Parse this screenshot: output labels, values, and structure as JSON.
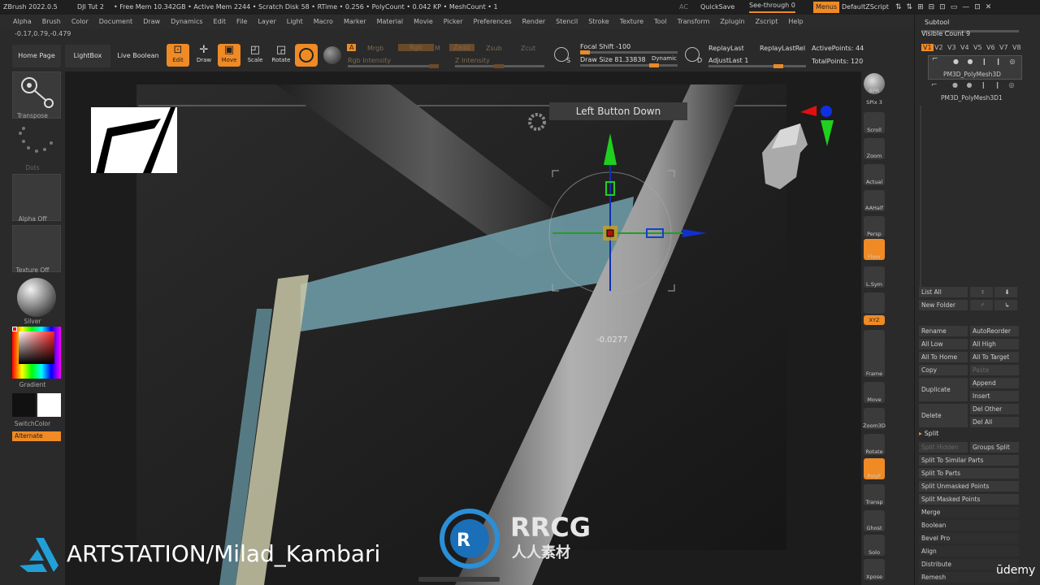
{
  "titlebar": {
    "app": "ZBrush 2022.0.5",
    "doc": "DJI Tut 2",
    "stats": "• Free Mem 10.342GB • Active Mem 2244 • Scratch Disk 58 • RTime • 0.256 • PolyCount • 0.042 KP • MeshCount • 1",
    "ac": "AC",
    "quicksave": "QuickSave",
    "seethrough": "See-through 0",
    "menus": "Menus",
    "script": "DefaultZScript"
  },
  "menu": [
    "Alpha",
    "Brush",
    "Color",
    "Document",
    "Draw",
    "Dynamics",
    "Edit",
    "File",
    "Layer",
    "Light",
    "Macro",
    "Marker",
    "Material",
    "Movie",
    "Picker",
    "Preferences",
    "Render",
    "Stencil",
    "Stroke",
    "Texture",
    "Tool",
    "Transform",
    "Zplugin",
    "Zscript",
    "Help"
  ],
  "coords": "-0.17,0.79,-0.479",
  "shelf": {
    "home": "Home Page",
    "lightbox": "LightBox",
    "liveboolean": "Live Boolean",
    "edit": "Edit",
    "draw": "Draw",
    "move": "Move",
    "scale": "Scale",
    "rotate": "Rotate",
    "a": "A",
    "mrgb": "Mrgb",
    "rgb": "Rgb",
    "m": "M",
    "zadd": "Zadd",
    "zsub": "Zsub",
    "zcut": "Zcut",
    "rgb_intensity": "Rgb Intensity",
    "z_intensity": "Z Intensity",
    "focal_shift": "Focal Shift -100",
    "draw_size": "Draw Size 81.33838",
    "dynamic": "Dynamic",
    "s": "S",
    "d": "D",
    "replay_last": "ReplayLast",
    "replay_last_rel": "ReplayLastRel",
    "adjust_last": "AdjustLast 1",
    "active_points": "ActivePoints: 44",
    "total_points": "TotalPoints: 120"
  },
  "left": {
    "transpose": "Transpose",
    "dots": "Dots",
    "alpha_off": "Alpha Off",
    "texture_off": "Texture Off",
    "silver": "Silver",
    "gradient": "Gradient",
    "switchcolor": "SwitchColor",
    "alternate": "Alternate"
  },
  "viewport": {
    "tooltip": "Left Button Down",
    "value": "-0.0277"
  },
  "right": [
    "BPR",
    "SPix 3",
    "Scroll",
    "Zoom",
    "Actual",
    "AAHalf",
    "Persp",
    "Floor",
    "L.Sym",
    "",
    "XYZ",
    "",
    "",
    "Frame",
    "Move",
    "Zoom3D",
    "Rotate",
    "PolyF",
    "Transp",
    "Ghost",
    "Solo",
    "Xpose"
  ],
  "subtool": {
    "title": "Subtool",
    "visible_count": "Visible Count 9",
    "vtabs": [
      "V1",
      "V2",
      "V3",
      "V4",
      "V5",
      "V6",
      "V7",
      "V8"
    ],
    "items": [
      "PM3D_PolyMesh3D",
      "PM3D_PolyMesh3D1"
    ],
    "list_all": "List All",
    "new_folder": "New Folder",
    "rename": "Rename",
    "autoreorder": "AutoReorder",
    "all_low": "All Low",
    "all_high": "All High",
    "all_to_home": "All To Home",
    "all_to_target": "All To Target",
    "copy": "Copy",
    "paste": "Paste",
    "duplicate": "Duplicate",
    "append": "Append",
    "insert": "Insert",
    "delete": "Delete",
    "del_other": "Del Other",
    "del_all": "Del All",
    "split": "Split",
    "split_hidden": "Split Hidden",
    "groups_split": "Groups Split",
    "split_similar": "Split To Similar Parts",
    "split_parts": "Split To Parts",
    "split_unmasked": "Split Unmasked Points",
    "split_masked": "Split Masked Points",
    "merge": "Merge",
    "boolean": "Boolean",
    "bevel_pro": "Bevel Pro",
    "align": "Align",
    "distribute": "Distribute",
    "remesh": "Remesh"
  },
  "watermark": {
    "artstation": "ARTSTATION/Milad_Kambari",
    "rrcg": "RRCG",
    "rrcg_cn": "人人素材",
    "udemy": "ūdemy"
  },
  "colors": {
    "accent": "#ef8a25",
    "teal": "#6b9aa6",
    "gizmo_green": "#1fc01f",
    "gizmo_blue": "#1030d0",
    "gizmo_red": "#e01010"
  }
}
